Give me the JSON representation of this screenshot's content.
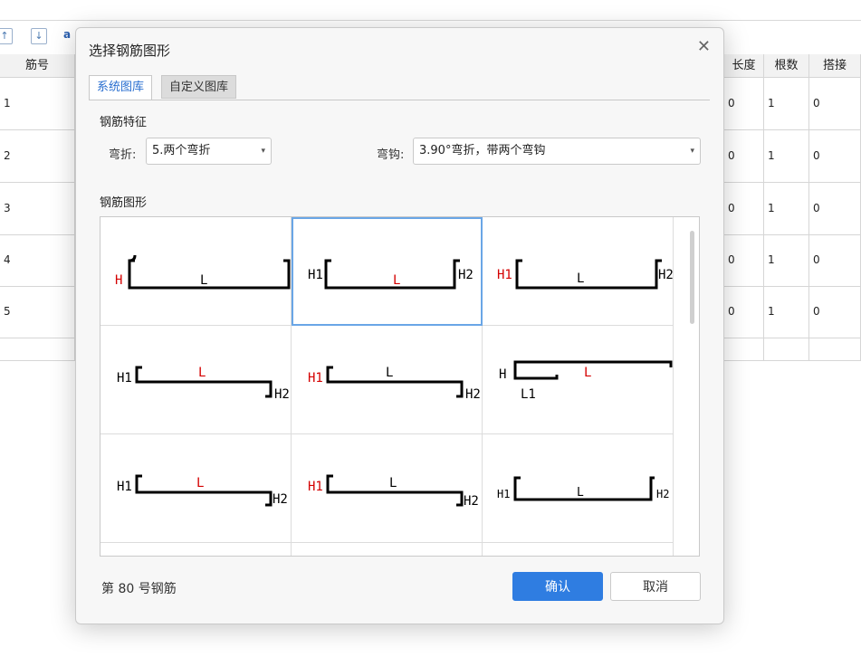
{
  "background": {
    "toolbar": {
      "az_label": "a"
    },
    "headers": [
      "筋号",
      "长度",
      "根数",
      "搭接"
    ],
    "rows": [
      {
        "num": "1",
        "length": "0",
        "count": "1",
        "lap": "0"
      },
      {
        "num": "2",
        "length": "0",
        "count": "1",
        "lap": "0"
      },
      {
        "num": "3",
        "length": "0",
        "count": "1",
        "lap": "0"
      },
      {
        "num": "4",
        "length": "0",
        "count": "1",
        "lap": "0"
      },
      {
        "num": "5",
        "length": "0",
        "count": "1",
        "lap": "0"
      }
    ]
  },
  "dialog": {
    "title": "选择钢筋图形",
    "tabs": [
      {
        "label": "系统图库",
        "active": true
      },
      {
        "label": "自定义图库",
        "active": false
      }
    ],
    "features_label": "钢筋特征",
    "bend_label": "弯折:",
    "bend_value": "5.两个弯折",
    "hook_label": "弯钩:",
    "hook_value": "3.90°弯折，带两个弯钩",
    "shapes_label": "钢筋图形",
    "shapes": [
      {
        "labels": [
          "H",
          "L"
        ],
        "red": [
          "H"
        ]
      },
      {
        "labels": [
          "H1",
          "L",
          "H2"
        ],
        "red": [
          "L"
        ],
        "selected": true
      },
      {
        "labels": [
          "H1",
          "L",
          "H2"
        ],
        "red": [
          "H1"
        ]
      },
      {
        "labels": [
          "H1",
          "L",
          "H2"
        ],
        "red": [
          "L"
        ]
      },
      {
        "labels": [
          "H1",
          "L",
          "H2"
        ],
        "red": [
          "H1"
        ]
      },
      {
        "labels": [
          "H",
          "L",
          "L1"
        ],
        "red": [
          "L"
        ]
      },
      {
        "labels": [
          "H1",
          "L",
          "H2"
        ],
        "red": [
          "L"
        ]
      },
      {
        "labels": [
          "H1",
          "L",
          "H2"
        ],
        "red": [
          "H1"
        ]
      },
      {
        "labels": [
          "H1",
          "L",
          "H2"
        ],
        "red": []
      }
    ],
    "footer_text": "第 80 号钢筋",
    "confirm_label": "确认",
    "cancel_label": "取消",
    "colors": {
      "accent": "#2f7de1",
      "highlight": "#d40000",
      "selection": "#6aa6e6"
    }
  }
}
